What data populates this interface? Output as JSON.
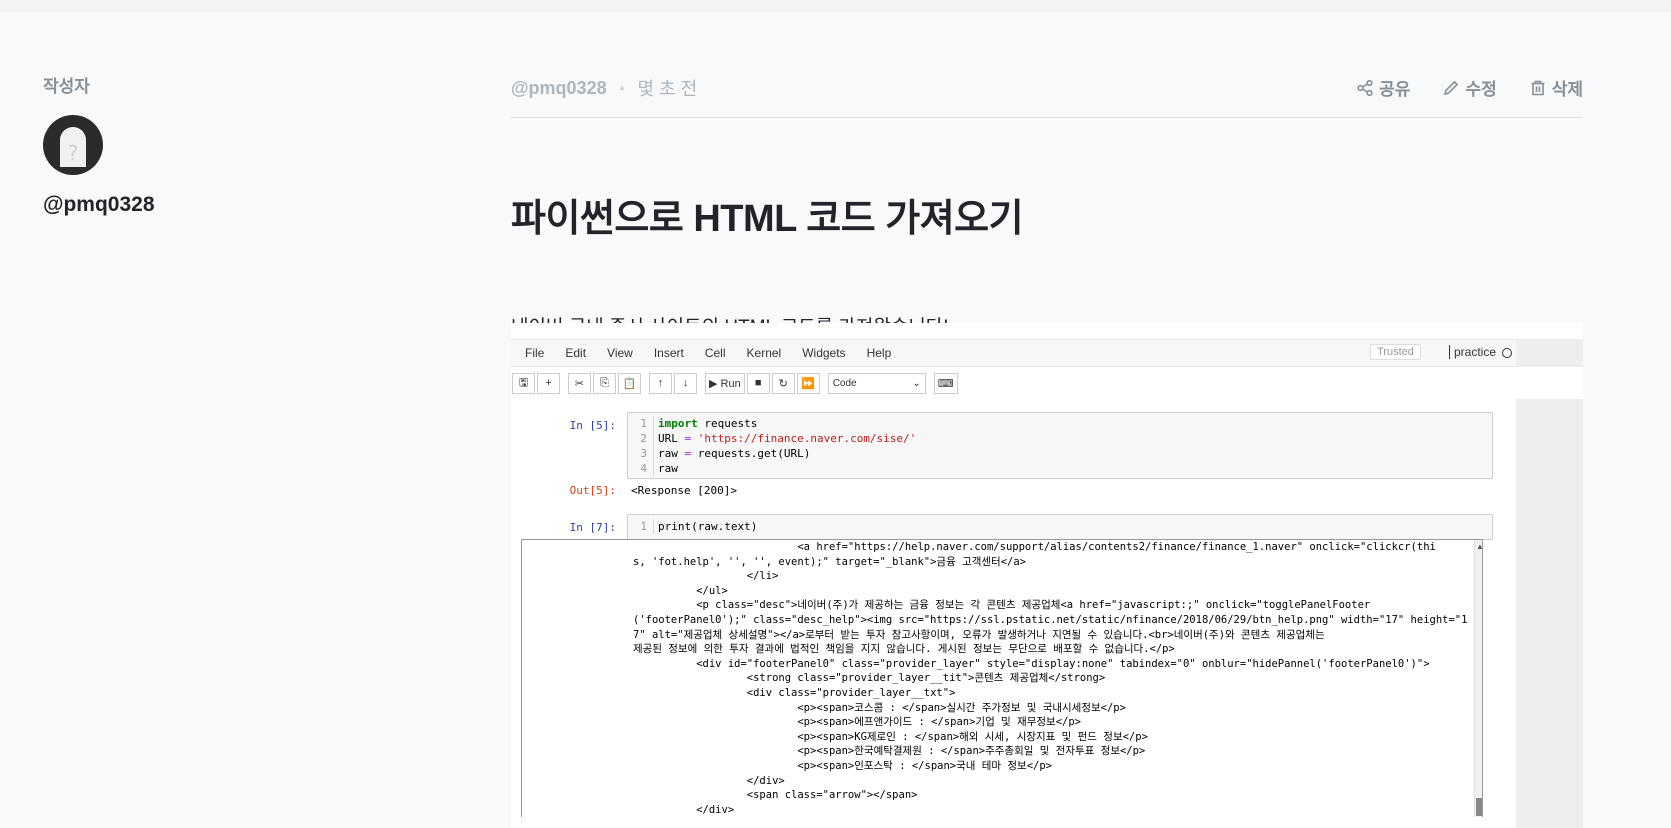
{
  "author": {
    "heading": "작성자",
    "name": "@pmq0328",
    "avatar_glyph": "?"
  },
  "meta": {
    "user": "@pmq0328",
    "dot": "•",
    "time": "몇 초 전",
    "actions": {
      "share": "공유",
      "edit": "수정",
      "delete": "삭제"
    }
  },
  "post": {
    "title": "파이썬으로 HTML 코드 가져오기",
    "intro": "네이버 국내 증시 사이트의 HTML 코드를 가져왔습니다!"
  },
  "jupyter": {
    "menu": [
      "File",
      "Edit",
      "View",
      "Insert",
      "Cell",
      "Kernel",
      "Widgets",
      "Help"
    ],
    "trusted": "Trusted",
    "kernel_name": "practice",
    "toolbar": {
      "save": "🖫",
      "add": "+",
      "cut": "✂",
      "copy": "⎘",
      "paste": "📋",
      "up": "↑",
      "down": "↓",
      "run": "▶ Run",
      "stop": "■",
      "restart": "↻",
      "fast_forward": "⏩",
      "cell_type": "Code",
      "keyboard": "⌨"
    },
    "cells": {
      "in5_prompt": "In [5]:",
      "in5_lines": {
        "l1_num": "1",
        "l1_kw": "import",
        "l1_rest": " requests",
        "l2_num": "2",
        "l2_a": "URL ",
        "l2_op": "=",
        "l2_str": " 'https://finance.naver.com/sise/'",
        "l3_num": "3",
        "l3_a": "raw ",
        "l3_op": "=",
        "l3_b": " requests.get(URL)",
        "l4_num": "4",
        "l4_a": "raw"
      },
      "out5_prompt": "Out[5]:",
      "out5_text": "<Response [200]>",
      "in7_prompt": "In [7]:",
      "in7_line_num": "1",
      "in7_code": "print(raw.text)"
    },
    "output_lines": [
      "                          <a href=\"https://help.naver.com/support/alias/contents2/finance/finance_1.naver\" onclick=\"clickcr(thi",
      "s, 'fot.help', '', '', event);\" target=\"_blank\">금융 고객센터</a>",
      "                  </li>",
      "          </ul>",
      "          <p class=\"desc\">네이버(주)가 제공하는 금융 정보는 각 콘텐츠 제공업체<a href=\"javascript:;\" onclick=\"togglePanelFooter",
      "('footerPanel0');\" class=\"desc_help\"><img src=\"https://ssl.pstatic.net/static/nfinance/2018/06/29/btn_help.png\" width=\"17\" height=\"1",
      "7\" alt=\"제공업체 상세설명\"></a>로부터 받는 투자 참고사항이며, 오류가 발생하거나 지연될 수 있습니다.<br>네이버(주)와 콘텐츠 제공업체는",
      "제공된 정보에 의한 투자 결과에 법적인 책임을 지지 않습니다. 게시된 정보는 무단으로 배포할 수 없습니다.</p>",
      "          <div id=\"footerPanel0\" class=\"provider_layer\" style=\"display:none\" tabindex=\"0\" onblur=\"hidePannel('footerPanel0')\">",
      "                  <strong class=\"provider_layer__tit\">콘텐츠 제공업체</strong>",
      "                  <div class=\"provider_layer__txt\">",
      "                          <p><span>코스콤 : </span>실시간 주가정보 및 국내시세정보</p>",
      "                          <p><span>에프앤가이드 : </span>기업 및 재무정보</p>",
      "                          <p><span>KG제로인 : </span>해외 시세, 시장지표 및 펀드 정보</p>",
      "                          <p><span>한국예탁결제원 : </span>주주총회일 및 전자투표 정보</p>",
      "                          <p><span>인포스탁 : </span>국내 테마 정보</p>",
      "                  </div>",
      "                  <span class=\"arrow\"></span>",
      "          </div>"
    ]
  }
}
